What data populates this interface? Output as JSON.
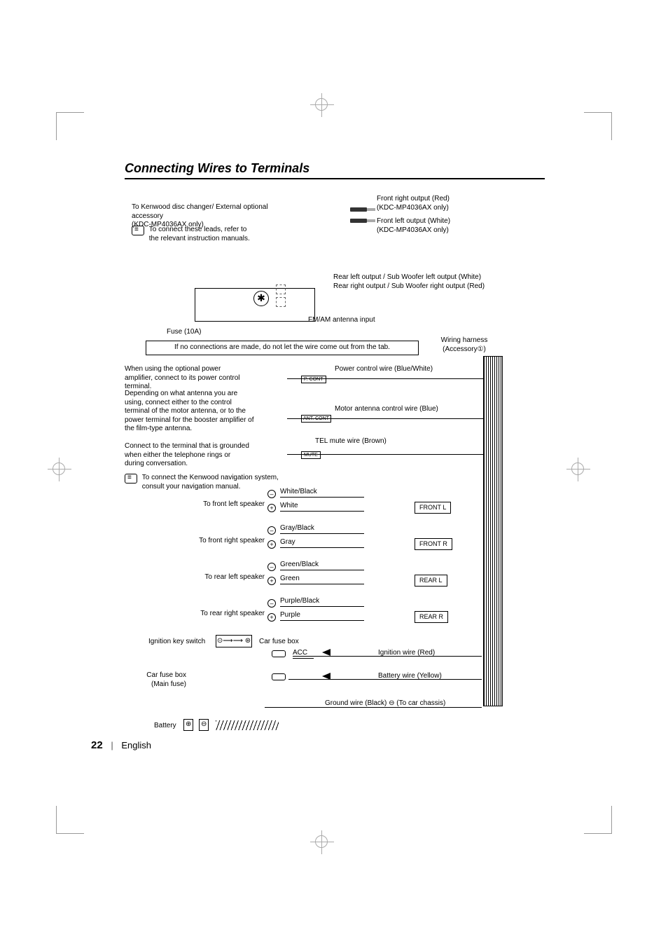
{
  "title": "Connecting Wires to Terminals",
  "top": {
    "disc_changer": "To Kenwood disc changer/ External optional accessory",
    "disc_changer_model": "(KDC-MP4036AX only)",
    "manual_note": "To connect these leads, refer to the relevant instruction manuals.",
    "front_right": "Front right output (Red)",
    "front_right_model": "(KDC-MP4036AX only)",
    "front_left": "Front left output (White)",
    "front_left_model": "(KDC-MP4036AX only)",
    "rear_left": "Rear left output / Sub Woofer left output (White)",
    "rear_right": "Rear right output / Sub Woofer right output (Red)",
    "fm_am": "FM/AM antenna input",
    "fuse": "Fuse (10A)"
  },
  "mid": {
    "tab_note": "If no connections are made, do not let the wire come out from the tab.",
    "harness": "Wiring harness",
    "harness_sub": "(Accessory①)",
    "amp_note": "When using the optional power amplifier, connect to its power control terminal.",
    "ant_note": "Depending on what antenna you are using, connect either to the control terminal of the motor antenna, or to the power terminal for the booster amplifier of the film-type antenna.",
    "tel_note": "Connect to the terminal that is grounded when either the telephone rings or during conversation.",
    "nav_note": "To connect the Kenwood navigation system, consult your navigation manual.",
    "pcont_tag": "P. CONT",
    "antcont_tag": "ANT. CONT",
    "mute_tag": "MUTE",
    "pcont_wire": "Power control wire (Blue/White)",
    "ant_wire": "Motor antenna control wire (Blue)",
    "tel_wire": "TEL mute wire (Brown)"
  },
  "speakers": {
    "fl_label": "To front left speaker",
    "fl_neg": "White/Black",
    "fl_pos": "White",
    "fl_box": "FRONT  L",
    "fr_label": "To front right speaker",
    "fr_neg": "Gray/Black",
    "fr_pos": "Gray",
    "fr_box": "FRONT  R",
    "rl_label": "To rear left speaker",
    "rl_neg": "Green/Black",
    "rl_pos": "Green",
    "rl_box": "REAR  L",
    "rr_label": "To rear right speaker",
    "rr_neg": "Purple/Black",
    "rr_pos": "Purple",
    "rr_box": "REAR  R"
  },
  "power": {
    "ign_switch": "Ignition key switch",
    "car_fuse": "Car fuse box",
    "car_fuse_main": "Car fuse box\n(Main fuse)",
    "battery": "Battery",
    "acc": "ACC",
    "ign_wire": "Ignition wire (Red)",
    "bat_wire": "Battery wire (Yellow)",
    "gnd_wire": "Ground wire (Black) ⊖ (To car chassis)"
  },
  "footer": {
    "page": "22",
    "lang": "English"
  }
}
